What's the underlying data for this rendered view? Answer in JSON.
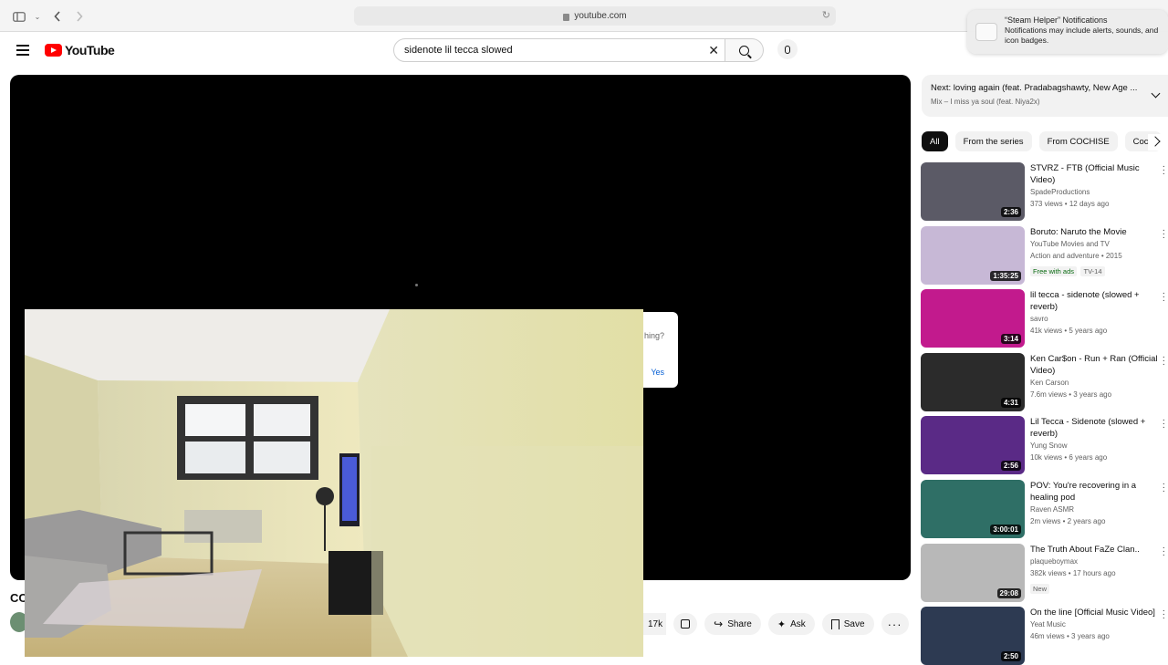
{
  "browser": {
    "url": "youtube.com"
  },
  "notification": {
    "title": "“Steam Helper” Notifications",
    "body": "Notifications may include alerts, sounds, and icon badges."
  },
  "header": {
    "logo": "YouTube",
    "search_value": "sidenote lil tecca slowed",
    "search_placeholder": "Search"
  },
  "player": {
    "popup_text": "hing?",
    "popup_yes": "Yes"
  },
  "below_video": {
    "title_fragment": "CO",
    "like_count": "17k",
    "share_label": "Share",
    "ask_label": "Ask",
    "save_label": "Save"
  },
  "sidebar": {
    "next_title": "Next: loving again (feat. Pradabagshawty, New Age ...",
    "next_sub": "Mix – I miss ya soul (feat. Niya2x)",
    "chips": [
      "All",
      "From the series",
      "From COCHISE",
      "Coch"
    ],
    "recs": [
      {
        "title": "STVRZ - FTB (Official Music Video)",
        "channel": "SpadeProductions",
        "meta": "373 views • 12 days ago",
        "duration": "2:36",
        "thumb_color": "#5b5a66"
      },
      {
        "title": "Boruto: Naruto the Movie",
        "channel": "YouTube Movies and TV",
        "meta": "Action and adventure • 2015",
        "duration": "1:35:25",
        "badge1": "Free with ads",
        "badge2": "TV-14",
        "thumb_color": "#c7b8d6"
      },
      {
        "title": "lil tecca - sidenote (slowed + reverb)",
        "channel": "savro",
        "meta": "41k views • 5 years ago",
        "duration": "3:14",
        "thumb_color": "#c21a8d"
      },
      {
        "title": "Ken Car$on - Run + Ran (Official Video)",
        "channel": "Ken Carson",
        "meta": "7.6m views • 3 years ago",
        "duration": "4:31",
        "thumb_color": "#2b2b2b"
      },
      {
        "title": "Lil Tecca - Sidenote (slowed + reverb)",
        "channel": "Yung Snow",
        "meta": "10k views • 6 years ago",
        "duration": "2:56",
        "thumb_color": "#5a2a86"
      },
      {
        "title": "POV: You're recovering in a healing pod",
        "channel": "Raven ASMR",
        "meta": "2m views • 2 years ago",
        "duration": "3:00:01",
        "thumb_color": "#2f6f66"
      },
      {
        "title": "The Truth About FaZe Clan..",
        "channel": "plaqueboymax",
        "meta": "382k views • 17 hours ago",
        "badge1": "New",
        "duration": "29:08",
        "thumb_color": "#b8b8b8"
      },
      {
        "title": "On the line [Official Music Video]",
        "channel": "Yeat Music",
        "meta": "46m views • 3 years ago",
        "duration": "2:50",
        "thumb_color": "#2d3a52"
      }
    ]
  }
}
